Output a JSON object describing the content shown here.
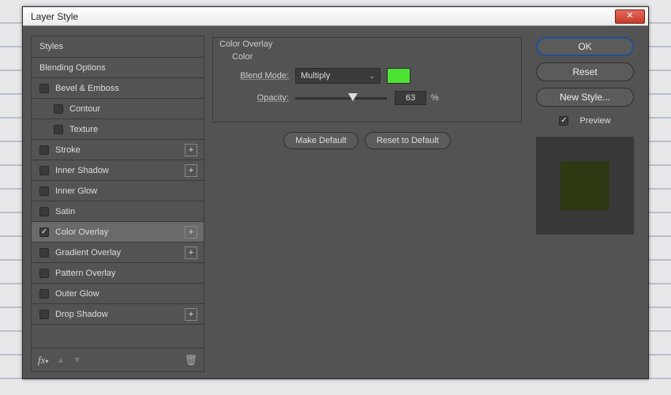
{
  "window": {
    "title": "Layer Style"
  },
  "leftPanel": {
    "header": "Styles",
    "blendingOptions": "Blending Options",
    "items": {
      "bevel": "Bevel & Emboss",
      "contour": "Contour",
      "texture": "Texture",
      "stroke": "Stroke",
      "innerShadow": "Inner Shadow",
      "innerGlow": "Inner Glow",
      "satin": "Satin",
      "colorOverlay": "Color Overlay",
      "gradientOverlay": "Gradient Overlay",
      "patternOverlay": "Pattern Overlay",
      "outerGlow": "Outer Glow",
      "dropShadow": "Drop Shadow"
    }
  },
  "mid": {
    "groupTitle": "Color Overlay",
    "colorLabel": "Color",
    "blendModeLabel": "Blend Mode:",
    "blendModeValue": "Multiply",
    "swatchColor": "#4BE234",
    "opacityLabel": "Opacity:",
    "opacityValue": "63",
    "opacityPct": 63,
    "pctSymbol": "%",
    "makeDefault": "Make Default",
    "resetDefault": "Reset to Default"
  },
  "right": {
    "ok": "OK",
    "reset": "Reset",
    "newStyle": "New Style...",
    "previewLabel": "Preview"
  }
}
